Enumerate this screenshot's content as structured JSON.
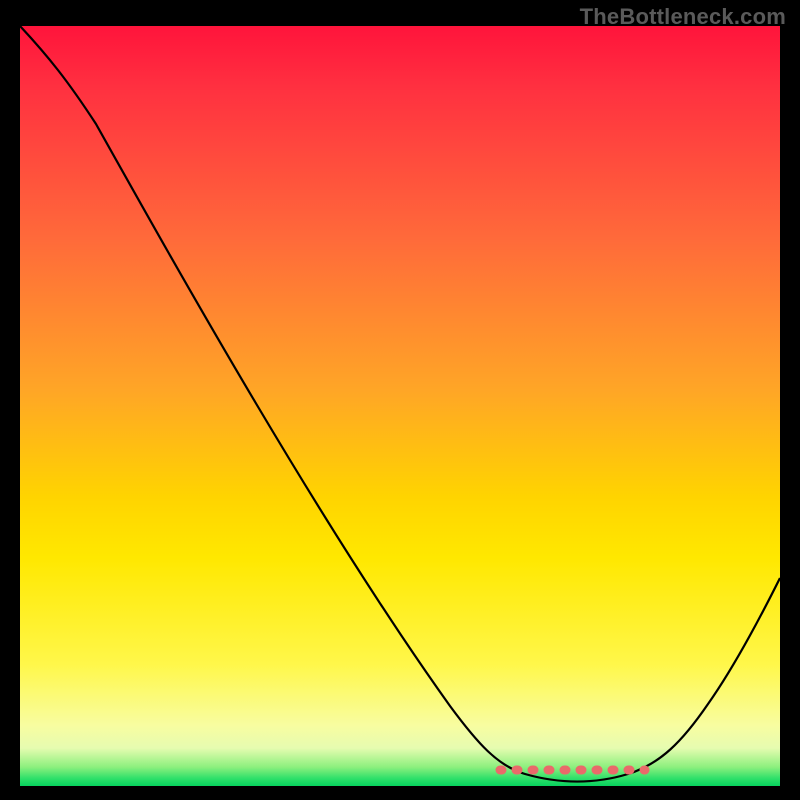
{
  "watermark": "TheBottleneck.com",
  "colors": {
    "page_bg": "#000000",
    "curve": "#000000",
    "plateau_marker": "#e96a6a",
    "gradient_top": "#ff143b",
    "gradient_bottom": "#07d25e"
  },
  "chart_data": {
    "type": "line",
    "title": "",
    "xlabel": "",
    "ylabel": "",
    "xlim": [
      0,
      100
    ],
    "ylim": [
      0,
      100
    ],
    "grid": false,
    "legend": false,
    "series": [
      {
        "name": "bottleneck-curve",
        "x": [
          0,
          5,
          10,
          15,
          20,
          25,
          30,
          35,
          40,
          45,
          50,
          55,
          60,
          63,
          66,
          70,
          74,
          78,
          82,
          86,
          90,
          95,
          100
        ],
        "values": [
          100,
          96,
          91,
          84,
          76,
          68,
          60,
          52,
          44,
          36,
          28,
          20,
          12,
          7,
          4,
          2,
          1,
          1,
          2,
          5,
          10,
          20,
          32
        ]
      }
    ],
    "annotations": [
      {
        "name": "plateau-dots",
        "style": "dotted",
        "color": "#e96a6a",
        "x_range": [
          63,
          83
        ],
        "y_approx": 2
      }
    ]
  }
}
